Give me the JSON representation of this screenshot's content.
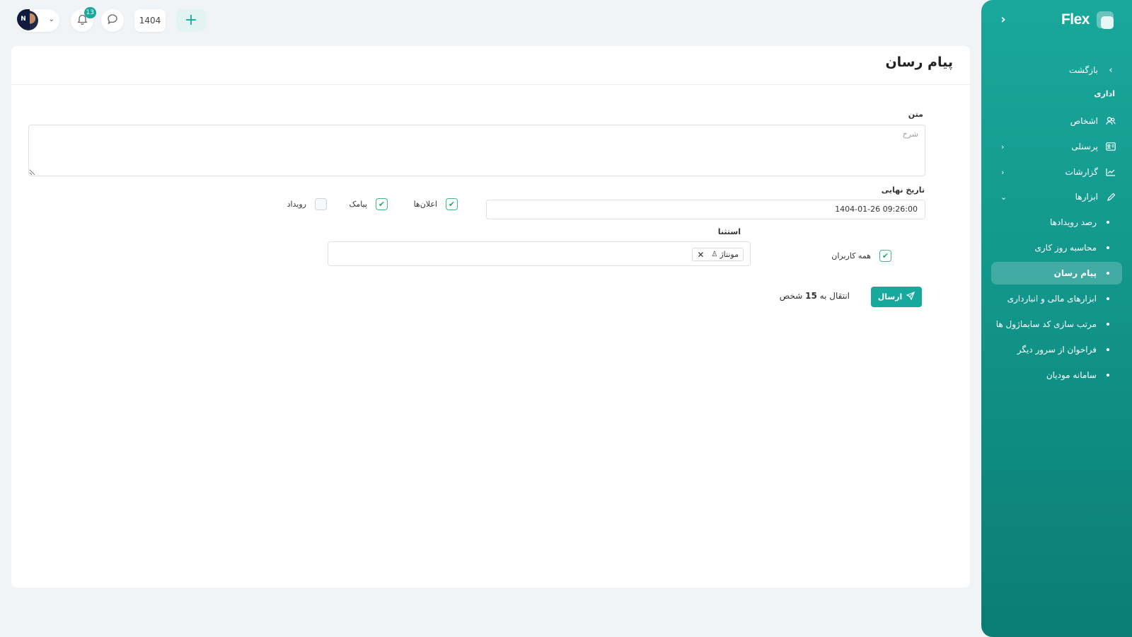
{
  "colors": {
    "accent": "#17a99c",
    "sidebar_top": "#1aa89c",
    "sidebar_bottom": "#0b7d73",
    "check": "#2fa36e"
  },
  "topbar": {
    "avatar_initial": "N",
    "notifications_count": "13",
    "year": "1404",
    "icons": [
      "chevron-down-icon",
      "bell-icon",
      "chat-icon",
      "plus-icon"
    ]
  },
  "sidebar": {
    "logo": "Flex",
    "back_label": "بازگشت",
    "section_label": "اداری",
    "items": [
      {
        "label": "اشخاص",
        "icon": "users-icon"
      },
      {
        "label": "پرسنلی",
        "icon": "id-card-icon"
      },
      {
        "label": "گزارشات",
        "icon": "chart-line-icon"
      },
      {
        "label": "ابزارها",
        "icon": "pencil-icon"
      }
    ],
    "subitems": [
      {
        "label": "رصد رویدادها"
      },
      {
        "label": "محاسبه روز کاری"
      },
      {
        "label": "پیام رسان",
        "active": true
      },
      {
        "label": "ابزارهای مالی و انبارداری"
      },
      {
        "label": "مرتب سازی کد سابماژول ها"
      },
      {
        "label": "فراخوان از سرور دیگر"
      },
      {
        "label": "سامانه مودیان"
      }
    ]
  },
  "form": {
    "page_title": "پیام رسان",
    "text_label": "متن",
    "text_placeholder": "شرح",
    "date_label": "تاریخ نهایی",
    "date_value": "1404-01-26 09:26:00",
    "channels": [
      {
        "label": "اعلان‌ها",
        "checked": true
      },
      {
        "label": "پیامک",
        "checked": true
      },
      {
        "label": "رویداد",
        "checked": false
      }
    ],
    "all_users_label": "همه کاربران",
    "all_users_checked": true,
    "exception_label": "استثنا",
    "exception_tags": [
      "مونتاژ"
    ],
    "send_label": "ارسال",
    "transfer_prefix": "انتقال به",
    "transfer_count": "15",
    "transfer_suffix": "شخص"
  }
}
